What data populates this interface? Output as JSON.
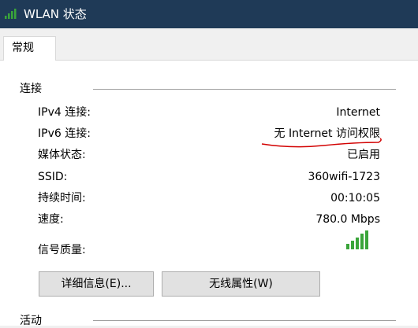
{
  "window": {
    "title": "WLAN 状态",
    "icon": "wifi-signal-icon"
  },
  "tabs": [
    {
      "label": "常规"
    }
  ],
  "connection": {
    "group_label": "连接",
    "rows": [
      {
        "label": "IPv4 连接:",
        "value": "Internet"
      },
      {
        "label": "IPv6 连接:",
        "value": "无 Internet 访问权限"
      },
      {
        "label": "媒体状态:",
        "value": "已启用"
      },
      {
        "label": "SSID:",
        "value": "360wifi-1723"
      },
      {
        "label": "持续时间:",
        "value": "00:10:05"
      },
      {
        "label": "速度:",
        "value": "780.0 Mbps"
      }
    ],
    "signal_label": "信号质量:",
    "signal_icon": "signal-bars-icon",
    "signal_bars": 5
  },
  "buttons": {
    "details": "详细信息(E)...",
    "wireless_props": "无线属性(W)"
  },
  "activity": {
    "group_label": "活动"
  },
  "colors": {
    "titlebar": "#1f3a57",
    "signal_green": "#3aa53a",
    "annotation_red": "#d20000"
  }
}
